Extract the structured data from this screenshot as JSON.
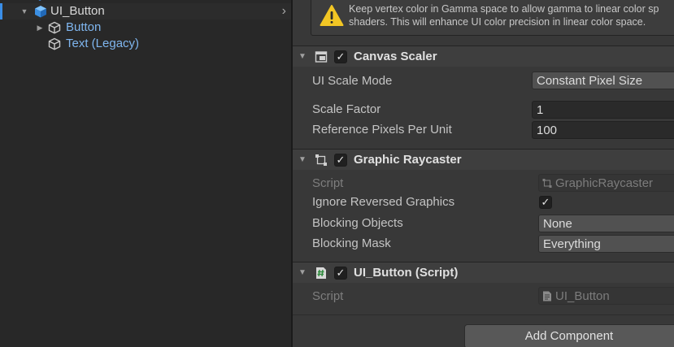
{
  "hierarchy": {
    "items": [
      {
        "label": "UI_Button",
        "expanded": true,
        "selected": true,
        "color": "white",
        "icon": "cube-filled-icon"
      },
      {
        "label": "Button",
        "expanded": false,
        "color": "blue",
        "icon": "cube-outline-icon"
      },
      {
        "label": "Text (Legacy)",
        "color": "blue",
        "icon": "cube-outline-icon"
      }
    ],
    "selected_row_chevron": "chevron-right-icon"
  },
  "inspector": {
    "help_box": {
      "icon": "warning-icon",
      "text": "Keep vertex color in Gamma space to allow gamma to linear color sp\nshaders. This will enhance UI color precision in linear color space."
    },
    "canvas_scaler": {
      "title": "Canvas Scaler",
      "enabled": true,
      "icon": "canvas-scaler-icon",
      "ui_scale_mode_label": "UI Scale Mode",
      "ui_scale_mode_value": "Constant Pixel Size",
      "scale_factor_label": "Scale Factor",
      "scale_factor_value": "1",
      "ref_pixels_label": "Reference Pixels Per Unit",
      "ref_pixels_value": "100"
    },
    "graphic_raycaster": {
      "title": "Graphic Raycaster",
      "enabled": true,
      "icon": "raycaster-icon",
      "script_label": "Script",
      "script_value": "GraphicRaycaster",
      "ignore_reversed_label": "Ignore Reversed Graphics",
      "ignore_reversed_checked": true,
      "blocking_objects_label": "Blocking Objects",
      "blocking_objects_value": "None",
      "blocking_mask_label": "Blocking Mask",
      "blocking_mask_value": "Everything"
    },
    "ui_button_script": {
      "title": "UI_Button (Script)",
      "enabled": true,
      "icon": "csharp-script-icon",
      "script_label": "Script",
      "script_value": "UI_Button"
    },
    "add_component_label": "Add Component"
  },
  "colors": {
    "selection_accent": "#3a8ee8",
    "hierarchy_child_text": "#7fb6ef",
    "warning_yellow": "#f2c624"
  }
}
